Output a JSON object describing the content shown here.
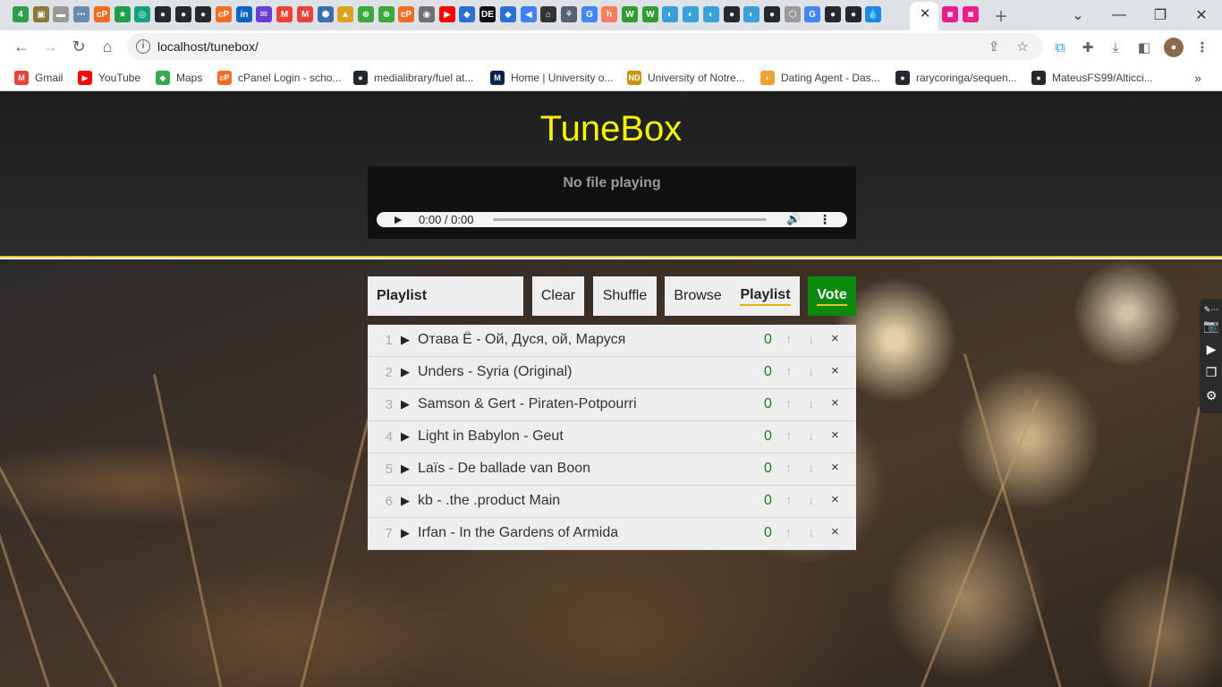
{
  "browser": {
    "tab_favicons": [
      {
        "name": "tab-favicon-1",
        "color": "#2e9e4a",
        "glyph": "4"
      },
      {
        "name": "tab-favicon-2",
        "color": "#8a7a3a",
        "glyph": "▣"
      },
      {
        "name": "tab-favicon-3",
        "color": "#9a9a9a",
        "glyph": "▬"
      },
      {
        "name": "tab-favicon-4",
        "color": "#6a8ab0",
        "glyph": "⋯"
      },
      {
        "name": "tab-favicon-5",
        "color": "#f26c22",
        "glyph": "cP"
      },
      {
        "name": "tab-favicon-6",
        "color": "#1e9e4a",
        "glyph": "★"
      },
      {
        "name": "tab-favicon-7",
        "color": "#10a37f",
        "glyph": "◎"
      },
      {
        "name": "tab-favicon-8",
        "color": "#24292f",
        "glyph": "●"
      },
      {
        "name": "tab-favicon-9",
        "color": "#24292f",
        "glyph": "●"
      },
      {
        "name": "tab-favicon-10",
        "color": "#24292f",
        "glyph": "●"
      },
      {
        "name": "tab-favicon-11",
        "color": "#f26c22",
        "glyph": "cP"
      },
      {
        "name": "tab-favicon-12",
        "color": "#0a66c2",
        "glyph": "in"
      },
      {
        "name": "tab-favicon-13",
        "color": "#6b3fd4",
        "glyph": "✉"
      },
      {
        "name": "tab-favicon-14",
        "color": "#ea4335",
        "glyph": "M"
      },
      {
        "name": "tab-favicon-15",
        "color": "#ea4335",
        "glyph": "M"
      },
      {
        "name": "tab-favicon-16",
        "color": "#3a6fb0",
        "glyph": "⬢"
      },
      {
        "name": "tab-favicon-17",
        "color": "#e0a020",
        "glyph": "▲"
      },
      {
        "name": "tab-favicon-18",
        "color": "#3aa83a",
        "glyph": "⊕"
      },
      {
        "name": "tab-favicon-19",
        "color": "#3aa83a",
        "glyph": "⊕"
      },
      {
        "name": "tab-favicon-20",
        "color": "#f26c22",
        "glyph": "cP"
      },
      {
        "name": "tab-favicon-21",
        "color": "#707070",
        "glyph": "◉"
      },
      {
        "name": "tab-favicon-22",
        "color": "#ff0000",
        "glyph": "▶"
      },
      {
        "name": "tab-favicon-23",
        "color": "#2a6fd4",
        "glyph": "◆"
      },
      {
        "name": "tab-favicon-24",
        "color": "#111111",
        "glyph": "DE"
      },
      {
        "name": "tab-favicon-25",
        "color": "#2a6fd4",
        "glyph": "◆"
      },
      {
        "name": "tab-favicon-26",
        "color": "#3b82f6",
        "glyph": "◀"
      },
      {
        "name": "tab-favicon-27",
        "color": "#333333",
        "glyph": "⌂"
      },
      {
        "name": "tab-favicon-28",
        "color": "#556070",
        "glyph": "⚘"
      },
      {
        "name": "tab-favicon-29",
        "color": "#4285f4",
        "glyph": "G"
      },
      {
        "name": "tab-favicon-30",
        "color": "#ff7a59",
        "glyph": "h"
      },
      {
        "name": "tab-favicon-31",
        "color": "#2e9e2e",
        "glyph": "W"
      },
      {
        "name": "tab-favicon-32",
        "color": "#2e9e2e",
        "glyph": "W"
      },
      {
        "name": "tab-favicon-33",
        "color": "#3aa0d8",
        "glyph": "◐"
      },
      {
        "name": "tab-favicon-34",
        "color": "#3aa0d8",
        "glyph": "◐"
      },
      {
        "name": "tab-favicon-35",
        "color": "#3aa0d8",
        "glyph": "◐"
      },
      {
        "name": "tab-favicon-36",
        "color": "#24292f",
        "glyph": "●"
      },
      {
        "name": "tab-favicon-37",
        "color": "#3aa0d8",
        "glyph": "◐"
      },
      {
        "name": "tab-favicon-38",
        "color": "#24292f",
        "glyph": "●"
      },
      {
        "name": "tab-favicon-39",
        "color": "#9a9a9a",
        "glyph": "⬡"
      },
      {
        "name": "tab-favicon-40",
        "color": "#4285f4",
        "glyph": "G"
      },
      {
        "name": "tab-favicon-41",
        "color": "#24292f",
        "glyph": "●"
      },
      {
        "name": "tab-favicon-42",
        "color": "#24292f",
        "glyph": "●"
      },
      {
        "name": "tab-favicon-43",
        "color": "#1e88e5",
        "glyph": "💧"
      },
      {
        "name": "tab-favicon-44",
        "color": "#e91e8c",
        "glyph": "◙"
      },
      {
        "name": "tab-favicon-45",
        "color": "#e91e8c",
        "glyph": "◙"
      }
    ],
    "url": "localhost/tunebox/",
    "bookmarks": [
      {
        "label": "Gmail",
        "icon": "gmail-icon",
        "color": "#ea4335",
        "glyph": "M"
      },
      {
        "label": "YouTube",
        "icon": "youtube-icon",
        "color": "#ff0000",
        "glyph": "▶"
      },
      {
        "label": "Maps",
        "icon": "maps-icon",
        "color": "#34a853",
        "glyph": "◆"
      },
      {
        "label": "cPanel Login - scho...",
        "icon": "cpanel-icon",
        "color": "#f26c22",
        "glyph": "cP"
      },
      {
        "label": "medialibrary/fuel at...",
        "icon": "github-icon",
        "color": "#24292f",
        "glyph": "●"
      },
      {
        "label": "Home | University o...",
        "icon": "michigan-icon",
        "color": "#00274c",
        "glyph": "M"
      },
      {
        "label": "University of Notre...",
        "icon": "notre-dame-icon",
        "color": "#c99700",
        "glyph": "ND"
      },
      {
        "label": "Dating Agent - Das...",
        "icon": "dating-agent-icon",
        "color": "#f0a030",
        "glyph": "◗"
      },
      {
        "label": "rarycoringa/sequen...",
        "icon": "github-icon",
        "color": "#24292f",
        "glyph": "●"
      },
      {
        "label": "MateusFS99/Alticci...",
        "icon": "github-icon",
        "color": "#24292f",
        "glyph": "●"
      }
    ]
  },
  "app": {
    "title": "TuneBox",
    "now_playing": "No file playing",
    "audio_time": "0:00 / 0:00",
    "playlist_label": "Playlist",
    "clear_label": "Clear",
    "shuffle_label": "Shuffle",
    "browse_label": "Browse",
    "playlist_tab_label": "Playlist",
    "vote_label": "Vote",
    "songs": [
      {
        "num": "1",
        "title": "Отава Ё - Ой, Дуся, ой, Маруся",
        "votes": "0"
      },
      {
        "num": "2",
        "title": "Unders - Syria (Original)",
        "votes": "0"
      },
      {
        "num": "3",
        "title": "Samson & Gert - Piraten-Potpourri",
        "votes": "0"
      },
      {
        "num": "4",
        "title": "Light in Babylon - Geut",
        "votes": "0"
      },
      {
        "num": "5",
        "title": "Laïs - De ballade van Boon",
        "votes": "0"
      },
      {
        "num": "6",
        "title": "kb - .the .product Main",
        "votes": "0"
      },
      {
        "num": "7",
        "title": "Irfan - In the Gardens of Armida",
        "votes": "0"
      }
    ],
    "colors": {
      "title": "#f5f500",
      "accent": "#e3c31c",
      "vote": "#0a8a0a",
      "votes_count": "#1d7a1d"
    }
  }
}
